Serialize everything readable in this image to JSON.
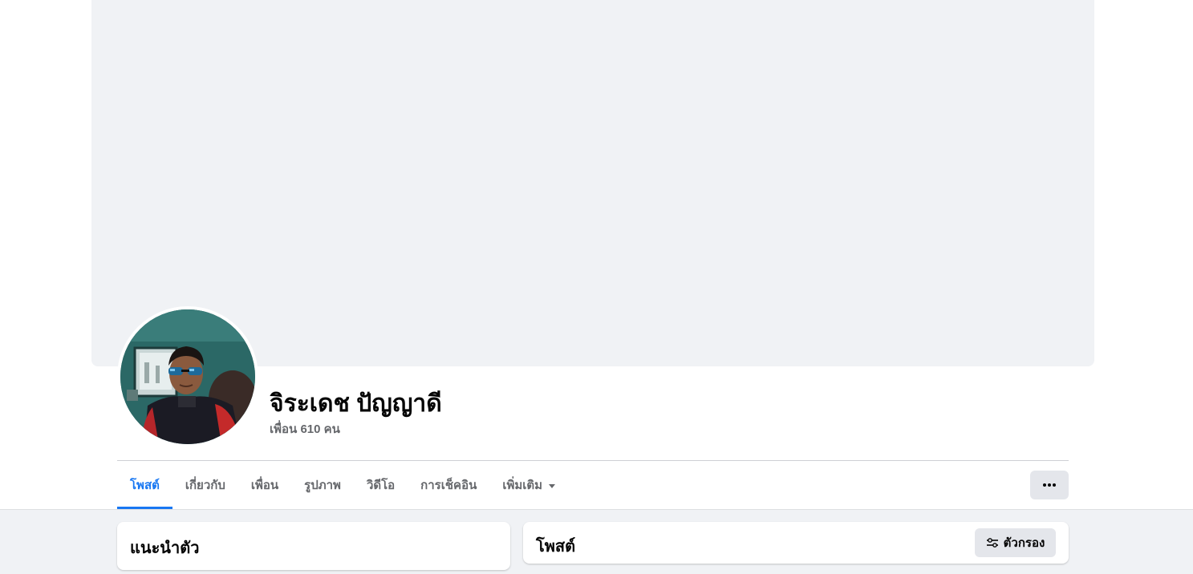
{
  "profile": {
    "name": "จิระเดช ปัญญาดี",
    "friends_count": "เพื่อน 610 คน"
  },
  "tabs": [
    {
      "label": "โพสต์",
      "active": true
    },
    {
      "label": "เกี่ยวกับ",
      "active": false
    },
    {
      "label": "เพื่อน",
      "active": false
    },
    {
      "label": "รูปภาพ",
      "active": false
    },
    {
      "label": "วิดีโอ",
      "active": false
    },
    {
      "label": "การเช็คอิน",
      "active": false
    },
    {
      "label": "เพิ่มเติม",
      "active": false
    }
  ],
  "intro": {
    "title": "แนะนำตัว"
  },
  "posts": {
    "title": "โพสต์",
    "filter_label": "ตัวกรอง"
  },
  "icons": {
    "more": "more-dots-icon",
    "dropdown": "caret-down-icon",
    "filter": "filter-sliders-icon"
  },
  "colors": {
    "accent": "#1877f2",
    "cover": "#f0f2f5",
    "button_bg": "#e4e6eb",
    "secondary_text": "#65676b"
  }
}
